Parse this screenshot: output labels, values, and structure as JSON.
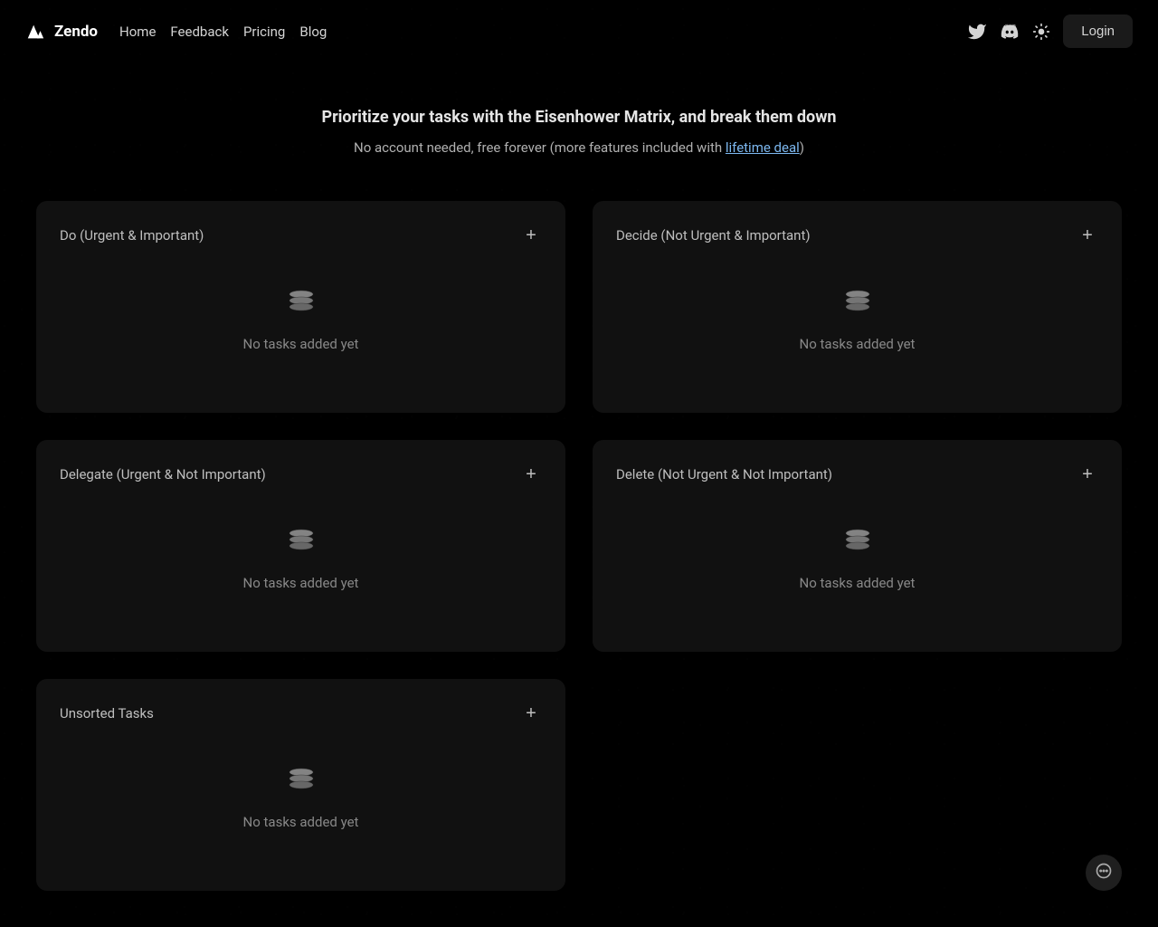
{
  "brand": "Zendo",
  "nav": {
    "home": "Home",
    "feedback": "Feedback",
    "pricing": "Pricing",
    "blog": "Blog"
  },
  "login_label": "Login",
  "hero": {
    "title": "Prioritize your tasks with the Eisenhower Matrix, and break them down",
    "subtitle_prefix": "No account needed, free forever (more features included with ",
    "subtitle_link": "lifetime deal",
    "subtitle_suffix": ")"
  },
  "cards": {
    "do": {
      "title": "Do (Urgent & Important)",
      "empty": "No tasks added yet"
    },
    "decide": {
      "title": "Decide (Not Urgent & Important)",
      "empty": "No tasks added yet"
    },
    "delegate": {
      "title": "Delegate (Urgent & Not Important)",
      "empty": "No tasks added yet"
    },
    "delete": {
      "title": "Delete (Not Urgent & Not Important)",
      "empty": "No tasks added yet"
    },
    "unsorted": {
      "title": "Unsorted Tasks",
      "empty": "No tasks added yet"
    }
  }
}
